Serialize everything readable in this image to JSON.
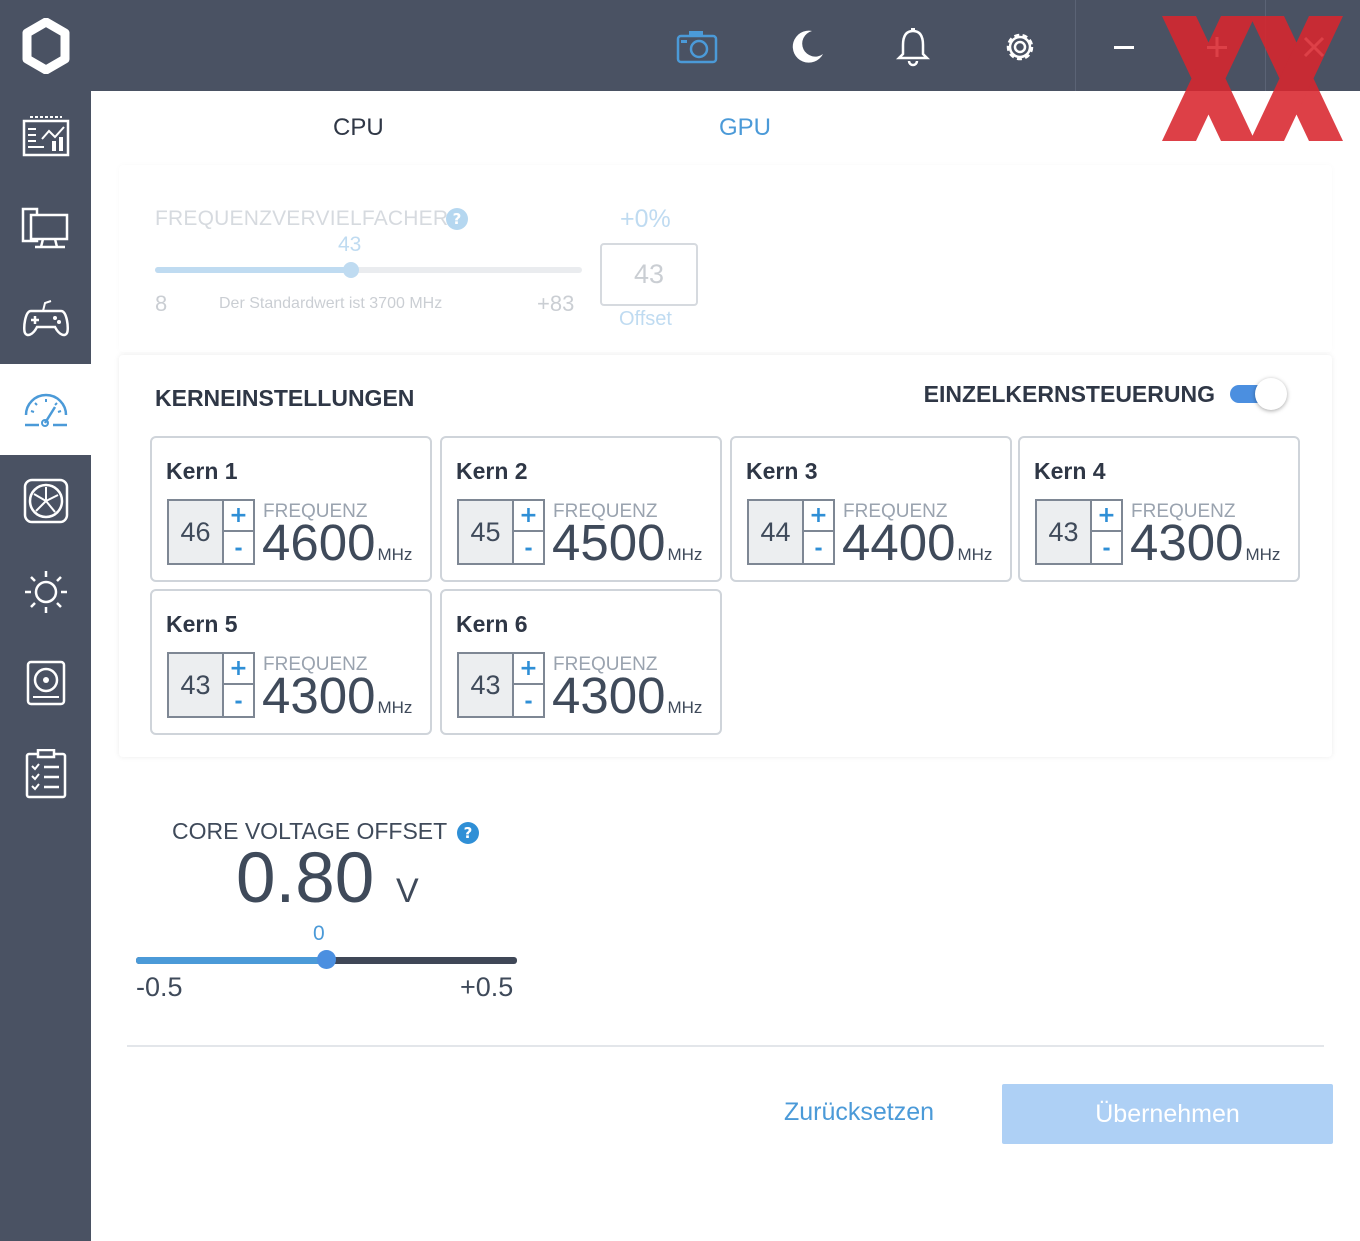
{
  "titlebar": {
    "icons": [
      "screenshot-icon",
      "moon-icon",
      "bell-icon",
      "gear-icon"
    ],
    "window_controls": [
      "minimize-icon",
      "maximize-icon",
      "close-icon"
    ],
    "accent": "#4b9ad8"
  },
  "sidebar": {
    "items": [
      {
        "icon": "dashboard-icon",
        "active": false
      },
      {
        "icon": "monitor-icon",
        "active": false
      },
      {
        "icon": "gamepad-icon",
        "active": false
      },
      {
        "icon": "speedometer-icon",
        "active": true
      },
      {
        "icon": "fan-icon",
        "active": false
      },
      {
        "icon": "brightness-icon",
        "active": false
      },
      {
        "icon": "disk-icon",
        "active": false
      },
      {
        "icon": "checklist-icon",
        "active": false
      }
    ]
  },
  "tabs": {
    "cpu": "CPU",
    "gpu": "GPU"
  },
  "frequency": {
    "label": "FREQUENZVERVIELFACHER",
    "slider_value": "43",
    "slider_fraction": 0.46,
    "min": "8",
    "default_text": "Der Standardwert ist 3700 MHz",
    "max": "+83",
    "percent": "+0%",
    "box_value": "43",
    "offset_label": "Offset"
  },
  "cores": {
    "title": "KERNEINSTELLUNGEN",
    "toggle_label": "EINZELKERNSTEUERUNG",
    "toggle_on": true,
    "freq_label": "FREQUENZ",
    "unit": "MHz",
    "plus": "+",
    "minus": "-",
    "items": [
      {
        "name": "Kern 1",
        "multiplier": "46",
        "freq": "4600"
      },
      {
        "name": "Kern 2",
        "multiplier": "45",
        "freq": "4500"
      },
      {
        "name": "Kern 3",
        "multiplier": "44",
        "freq": "4400"
      },
      {
        "name": "Kern 4",
        "multiplier": "43",
        "freq": "4300"
      },
      {
        "name": "Kern 5",
        "multiplier": "43",
        "freq": "4300"
      },
      {
        "name": "Kern 6",
        "multiplier": "43",
        "freq": "4300"
      }
    ]
  },
  "voltage": {
    "label": "CORE VOLTAGE OFFSET",
    "value": "0.80",
    "unit": "V",
    "slider_value": "0",
    "slider_fraction": 0.5,
    "min": "-0.5",
    "max": "+0.5"
  },
  "actions": {
    "reset": "Zurücksetzen",
    "apply": "Übernehmen"
  },
  "watermark": {
    "text": "XX",
    "color": "#d9262e"
  }
}
